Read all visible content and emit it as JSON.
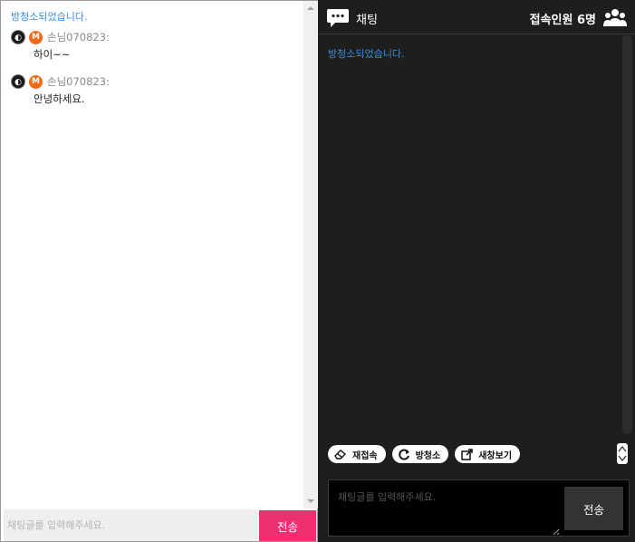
{
  "left": {
    "system_message": "방청소되었습니다.",
    "messages": [
      {
        "badge_level": "M",
        "user": "손님070823:",
        "text": "하이~~"
      },
      {
        "badge_level": "M",
        "user": "손님070823:",
        "text": "안녕하세요."
      }
    ],
    "input_placeholder": "채팅글를 입력해주세요.",
    "send_label": "전송"
  },
  "right": {
    "header": {
      "title": "채팅",
      "users": "접속인원 6명"
    },
    "system_message": "방청소되었습니다.",
    "tools": [
      {
        "label": "재접속",
        "icon": "eraser-icon"
      },
      {
        "label": "방청소",
        "icon": "refresh-icon"
      },
      {
        "label": "새창보기",
        "icon": "external-window-icon"
      }
    ],
    "input_placeholder": "채팅글를 입력해주세요.",
    "send_label": "전송"
  },
  "colors": {
    "accent_pink": "#ef2f6f",
    "system_blue": "#3a8fd9",
    "dark_bg": "#1e1e1e",
    "badge_orange": "#f06a1c"
  }
}
